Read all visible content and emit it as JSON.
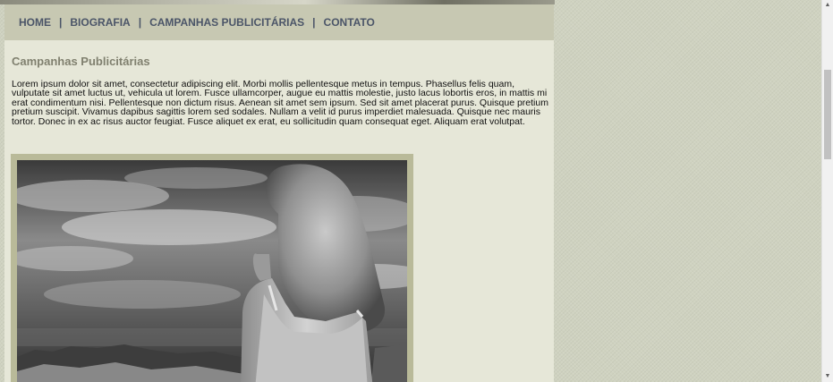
{
  "nav": {
    "items": [
      {
        "label": "HOME"
      },
      {
        "label": "BIOGRAFIA"
      },
      {
        "label": "CAMPANHAS PUBLICITÁRIAS"
      },
      {
        "label": "CONTATO"
      }
    ],
    "separator": "|"
  },
  "page": {
    "title": "Campanhas Publicitárias",
    "body": "Lorem ipsum dolor sit amet, consectetur adipiscing elit. Morbi mollis pellentesque metus in tempus. Phasellus felis quam, vulputate sit amet luctus ut, vehicula ut lorem. Fusce ullamcorper, augue eu mattis molestie, justo lacus lobortis eros, in mattis mi erat condimentum nisi. Pellentesque non dictum risus. Aenean sit amet sem ipsum. Sed sit amet placerat purus. Quisque pretium pretium suscipit. Vivamus dapibus sagittis lorem sed sodales. Nullam a velit id purus imperdiet malesuada. Quisque nec mauris tortor. Donec in ex ac risus auctor feugiat. Fusce aliquet ex erat, eu sollicitudin quam consequat eget. Aliquam erat volutpat."
  },
  "scrollbar": {
    "up_icon": "scroll-up-arrow",
    "down_icon": "scroll-down-arrow"
  },
  "colors": {
    "nav_bg": "#c7c8b2",
    "nav_text": "#4b5568",
    "content_bg": "#e6e7d8",
    "title": "#80806f",
    "frame": "#b9ba99"
  }
}
